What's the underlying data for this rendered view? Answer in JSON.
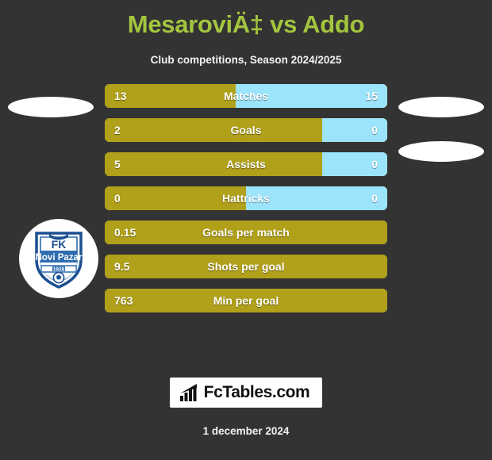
{
  "header": {
    "title": "MesaroviÄ‡ vs Addo",
    "subtitle": "Club competitions, Season 2024/2025"
  },
  "colors": {
    "background": "#333333",
    "title_green": "#a3c53e",
    "home_gold": "#b1a019",
    "away_blue": "#9ce4fb",
    "text_white": "#ffffff"
  },
  "badge": {
    "club_name": "FK Novi Pazar",
    "line1": "FK",
    "line2": "Novi Pazar",
    "founded": "1928"
  },
  "chart_data": {
    "type": "bar",
    "title": "MesaroviÄ‡ vs Addo",
    "subtitle": "Club competitions, Season 2024/2025",
    "orientation": "horizontal-diverging",
    "categories": [
      "Matches",
      "Goals",
      "Assists",
      "Hattricks",
      "Goals per match",
      "Shots per goal",
      "Min per goal"
    ],
    "series": [
      {
        "name": "home",
        "values": [
          "13",
          "2",
          "5",
          "0",
          "0.15",
          "9.5",
          "763"
        ]
      },
      {
        "name": "away",
        "values": [
          "15",
          "0",
          "0",
          "0",
          null,
          null,
          null
        ]
      }
    ]
  },
  "stats": [
    {
      "label": "Matches",
      "home": "13",
      "away": "15",
      "home_pct": 46.4,
      "dual": true
    },
    {
      "label": "Goals",
      "home": "2",
      "away": "0",
      "home_pct": 77.0,
      "dual": true
    },
    {
      "label": "Assists",
      "home": "5",
      "away": "0",
      "home_pct": 77.0,
      "dual": true
    },
    {
      "label": "Hattricks",
      "home": "0",
      "away": "0",
      "home_pct": 50.0,
      "dual": true
    },
    {
      "label": "Goals per match",
      "home": "0.15",
      "away": "",
      "home_pct": 100,
      "dual": false
    },
    {
      "label": "Shots per goal",
      "home": "9.5",
      "away": "",
      "home_pct": 100,
      "dual": false
    },
    {
      "label": "Min per goal",
      "home": "763",
      "away": "",
      "home_pct": 100,
      "dual": false
    }
  ],
  "footer": {
    "logo_text": "FcTables.com",
    "logo_icon": "bar-chart-icon",
    "date": "1 december 2024"
  }
}
